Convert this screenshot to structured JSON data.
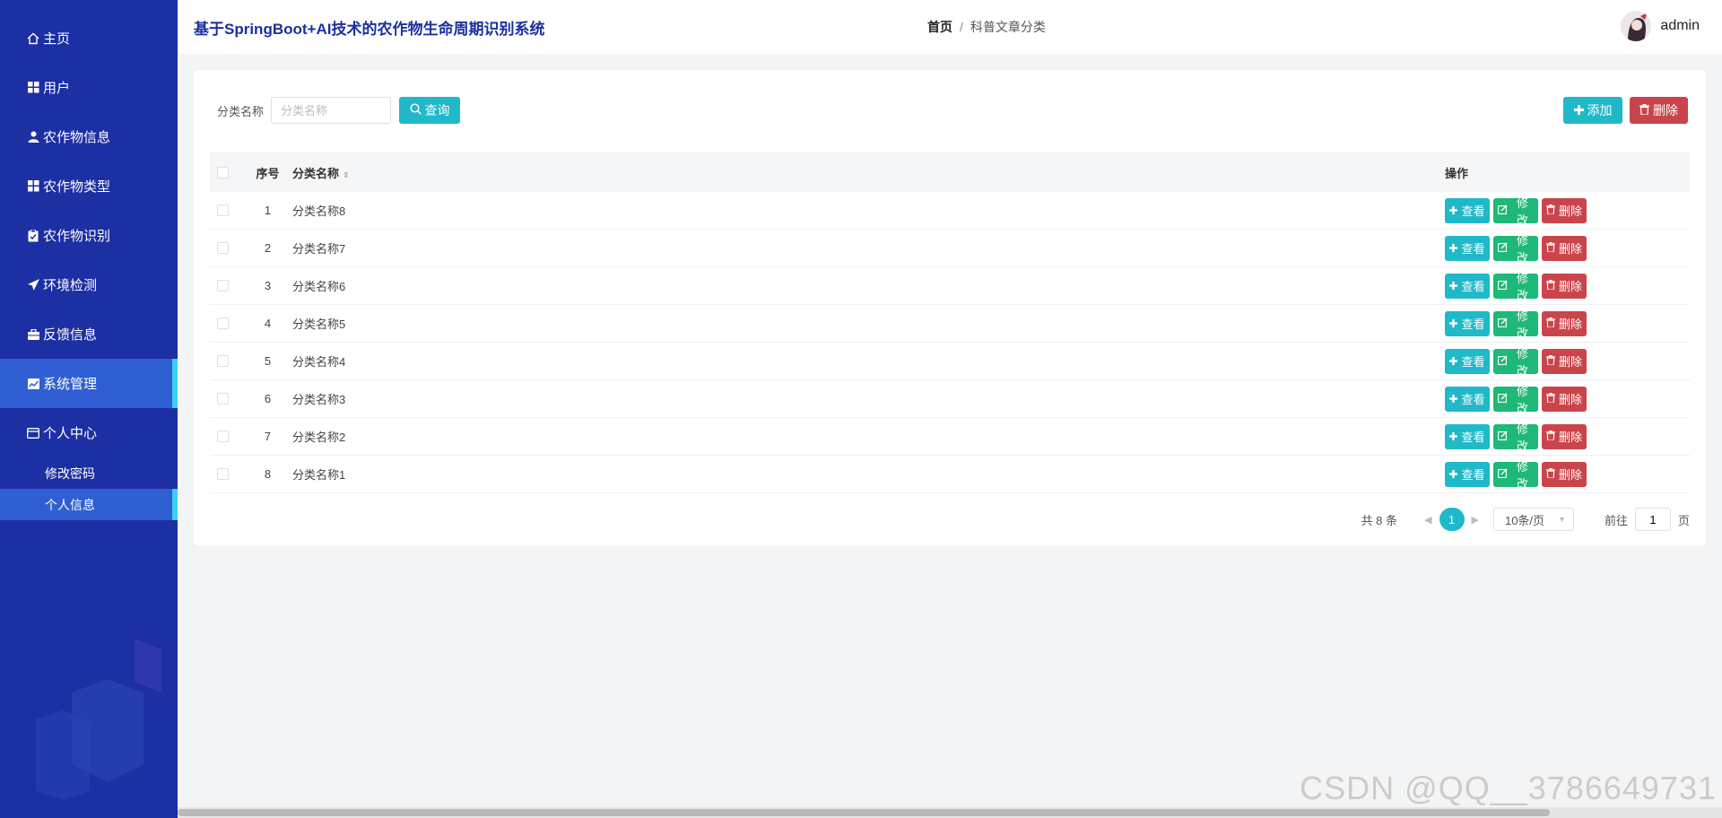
{
  "sidebar": {
    "items": [
      {
        "label": "主页",
        "icon": "home-icon"
      },
      {
        "label": "用户",
        "icon": "grid-icon"
      },
      {
        "label": "农作物信息",
        "icon": "user-icon"
      },
      {
        "label": "农作物类型",
        "icon": "grid-icon"
      },
      {
        "label": "农作物识别",
        "icon": "clipboard-icon"
      },
      {
        "label": "环境检测",
        "icon": "send-icon"
      },
      {
        "label": "反馈信息",
        "icon": "briefcase-icon"
      },
      {
        "label": "系统管理",
        "icon": "chart-icon"
      },
      {
        "label": "个人中心",
        "icon": "card-icon"
      }
    ],
    "subitems": [
      {
        "label": "修改密码"
      },
      {
        "label": "个人信息"
      }
    ],
    "colors": {
      "background": "#1c2fa3",
      "active": "#2f5fd3",
      "indicator": "#38d1f5"
    }
  },
  "header": {
    "title": "基于SpringBoot+AI技术的农作物生命周期识别系统",
    "breadcrumb": {
      "home": "首页",
      "separator": "/",
      "current": "科普文章分类"
    },
    "username": "admin"
  },
  "search": {
    "label": "分类名称",
    "placeholder": "分类名称",
    "value": "",
    "button": "查询"
  },
  "actions": {
    "add": "添加",
    "delete": "删除"
  },
  "table": {
    "headers": {
      "no": "序号",
      "name": "分类名称",
      "op": "操作"
    },
    "rows": [
      {
        "no": "1",
        "name": "分类名称8"
      },
      {
        "no": "2",
        "name": "分类名称7"
      },
      {
        "no": "3",
        "name": "分类名称6"
      },
      {
        "no": "4",
        "name": "分类名称5"
      },
      {
        "no": "5",
        "name": "分类名称4"
      },
      {
        "no": "6",
        "name": "分类名称3"
      },
      {
        "no": "7",
        "name": "分类名称2"
      },
      {
        "no": "8",
        "name": "分类名称1"
      }
    ],
    "row_buttons": {
      "view": "查看",
      "edit": "修改",
      "delete": "删除"
    }
  },
  "pagination": {
    "total": "共 8 条",
    "current_page": "1",
    "page_size": "10条/页",
    "goto_label": "前往",
    "goto_value": "1",
    "goto_suffix": "页"
  },
  "watermark": "CSDN @QQ__3786649731",
  "colors": {
    "accent": "#1fb9c9",
    "success": "#1eb878",
    "danger": "#c9454b"
  }
}
